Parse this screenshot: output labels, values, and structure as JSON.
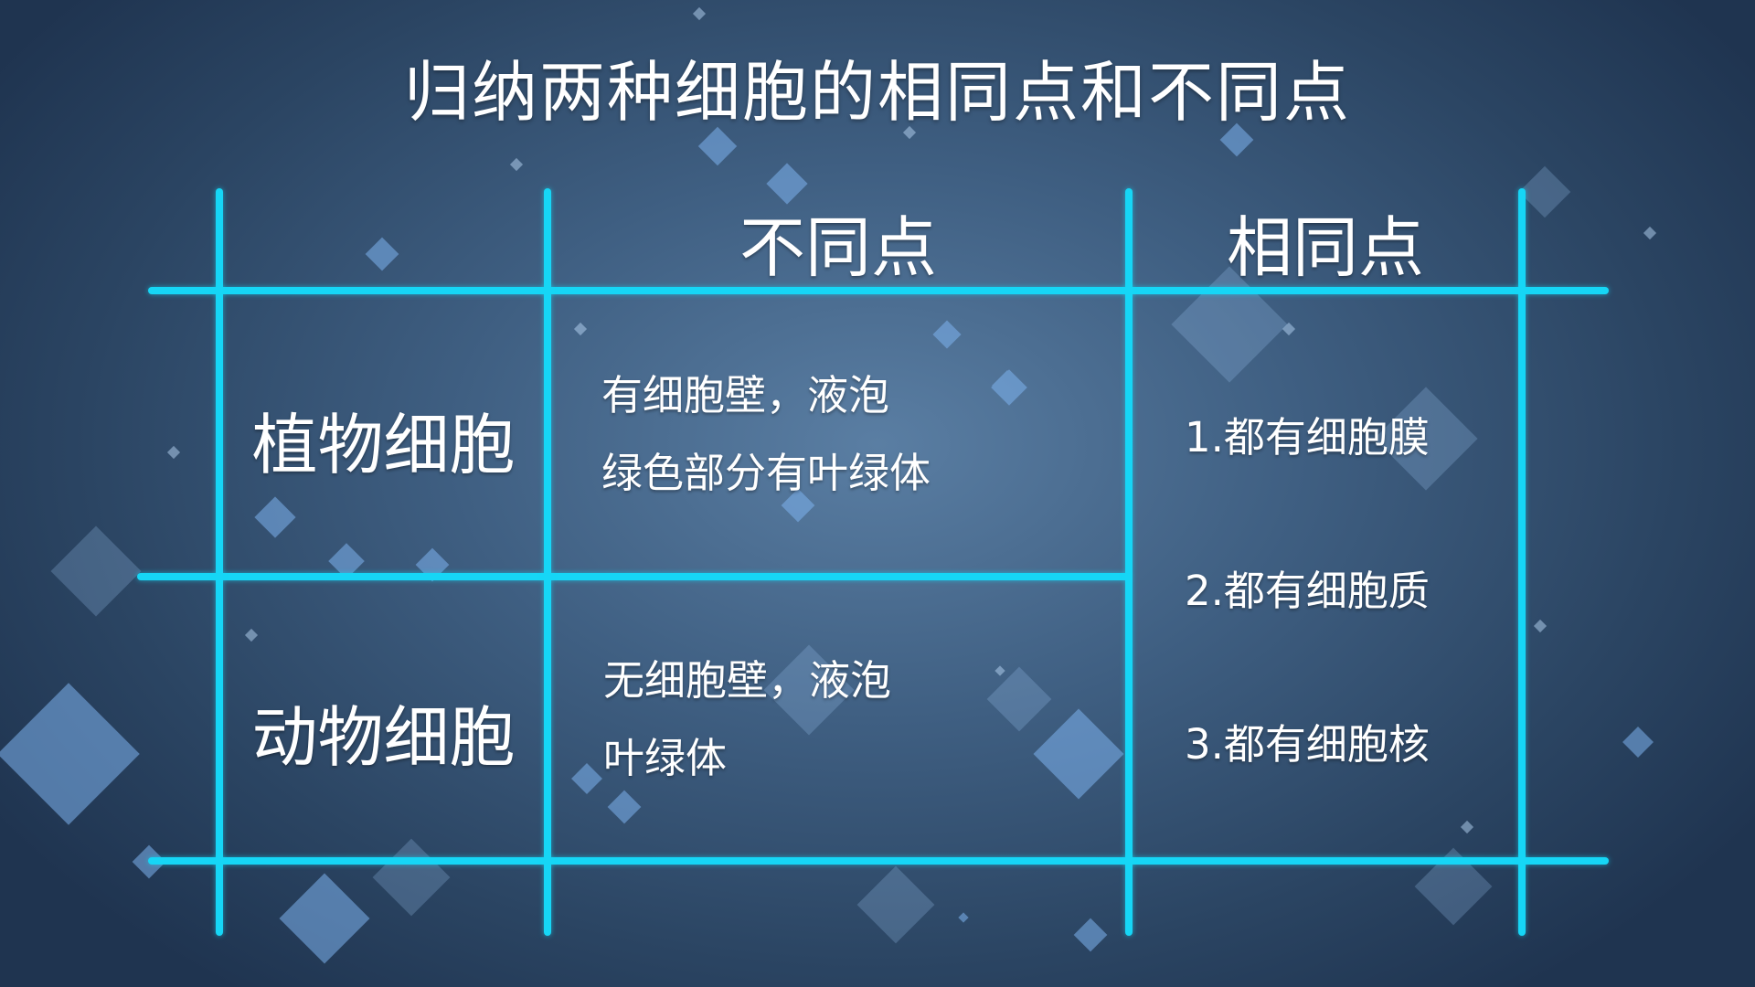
{
  "title": "归纳两种细胞的相同点和不同点",
  "table": {
    "headers": {
      "differences": "不同点",
      "similarities": "相同点"
    },
    "rows": [
      {
        "name": "植物细胞",
        "differences": [
          "有细胞壁，液泡",
          "绿色部分有叶绿体"
        ]
      },
      {
        "name": "动物细胞",
        "differences": [
          "无细胞壁，液泡",
          "叶绿体"
        ]
      }
    ],
    "similarities": [
      "1.都有细胞膜",
      "2.都有细胞质",
      "3.都有细胞核"
    ]
  },
  "colors": {
    "grid_line": "#16d6f6",
    "background": "#3f5f82",
    "text": "#ffffff"
  }
}
